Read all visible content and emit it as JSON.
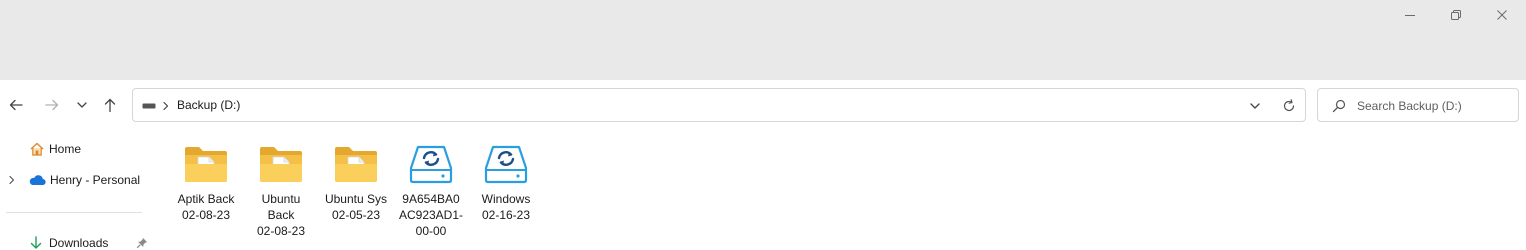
{
  "window": {
    "controls": {
      "minimize": "minimize",
      "maximize": "restore",
      "close": "close"
    }
  },
  "nav": {
    "back_icon": "arrow-left-icon",
    "forward_icon": "arrow-right-icon",
    "recent_icon": "chevron-down-icon",
    "up_icon": "arrow-up-icon"
  },
  "address": {
    "location": "Backup (D:)",
    "drive_icon": "drive-icon"
  },
  "search": {
    "placeholder": "Search Backup (D:)"
  },
  "sidebar": {
    "items": [
      {
        "label": "Home",
        "icon": "home-icon"
      },
      {
        "label": "Henry - Personal",
        "icon": "onedrive-cloud-icon"
      },
      {
        "label": "Downloads",
        "icon": "download-icon",
        "pinned": true
      }
    ]
  },
  "files": [
    {
      "line1": "Aptik Back",
      "line2": "02-08-23",
      "line3": "",
      "type": "folder"
    },
    {
      "line1": "Ubuntu",
      "line2": "Back",
      "line3": "02-08-23",
      "type": "folder"
    },
    {
      "line1": "Ubuntu Sys",
      "line2": "02-05-23",
      "line3": "",
      "type": "folder"
    },
    {
      "line1": "9A654BA0",
      "line2": "AC923AD1-",
      "line3": "00-00",
      "type": "backup-drive"
    },
    {
      "line1": "Windows",
      "line2": "02-16-23",
      "line3": "",
      "type": "backup-drive"
    }
  ],
  "colors": {
    "folder": "#f5c048",
    "folder_dark": "#e5a82e",
    "drive": "#2a9fe0",
    "cloud": "#1a73d8",
    "download": "#1e9e5a"
  }
}
